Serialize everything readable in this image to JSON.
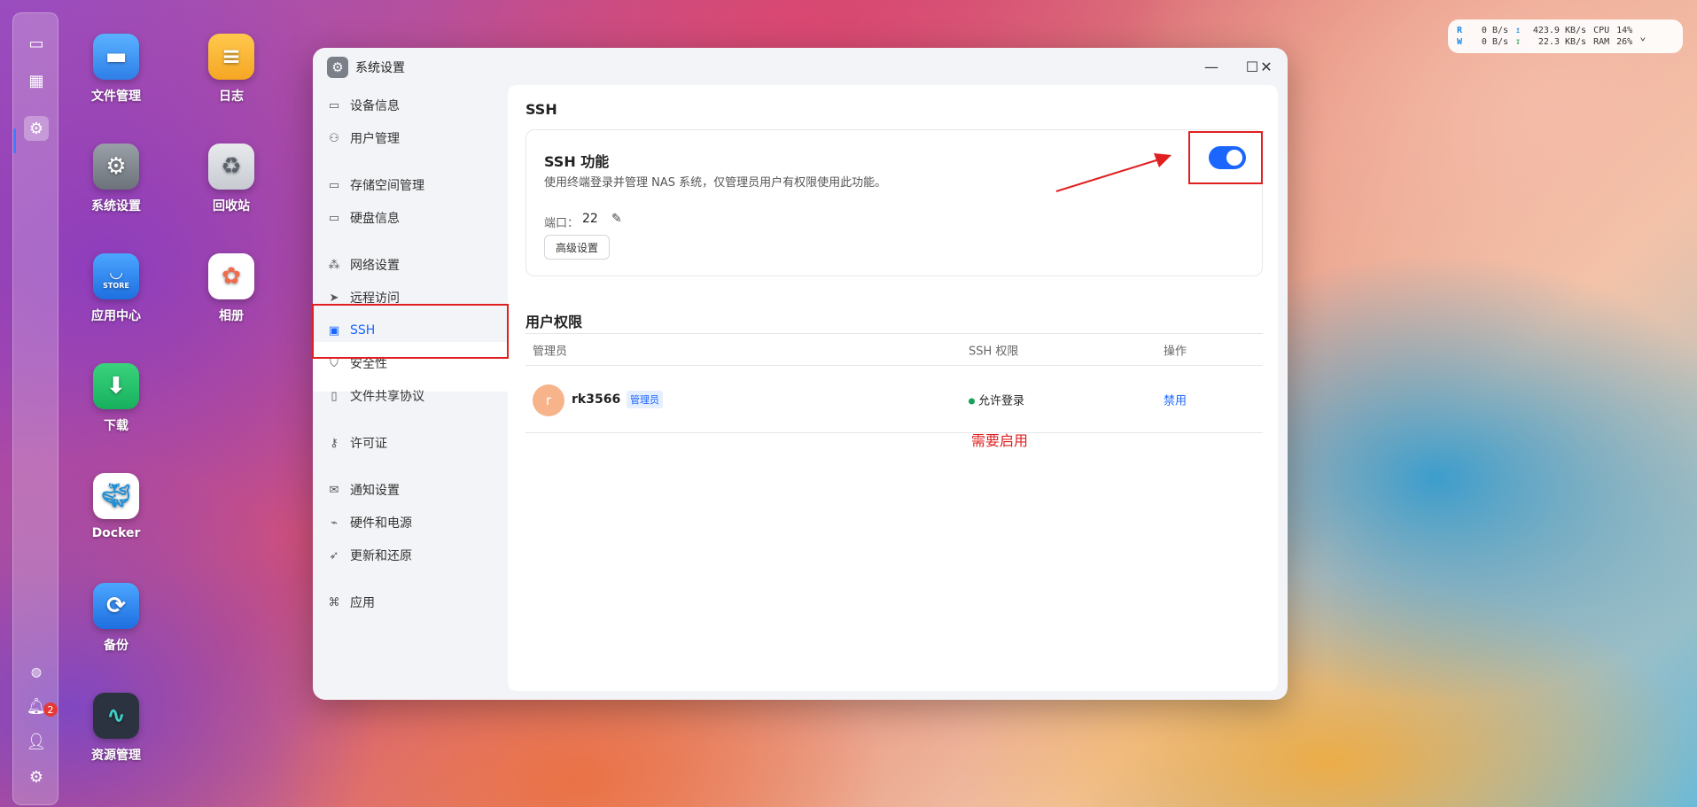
{
  "window": {
    "title": "系统设置"
  },
  "desktop_icons": [
    {
      "label": "文件管理",
      "icon": "folder-icon"
    },
    {
      "label": "日志",
      "icon": "log-icon"
    },
    {
      "label": "系统设置",
      "icon": "gear-icon"
    },
    {
      "label": "回收站",
      "icon": "recycle-bin-icon"
    },
    {
      "label": "应用中心",
      "icon": "store-icon",
      "sub": "STORE"
    },
    {
      "label": "相册",
      "icon": "photos-icon"
    },
    {
      "label": "下载",
      "icon": "download-icon"
    },
    {
      "label": "Docker",
      "icon": "docker-icon"
    },
    {
      "label": "备份",
      "icon": "backup-icon"
    },
    {
      "label": "资源管理",
      "icon": "resource-monitor-icon"
    }
  ],
  "dock": {
    "notification_count": "2"
  },
  "monitor": {
    "read_label": "R",
    "write_label": "W",
    "read_rate": "0  B/s",
    "write_rate": "0  B/s",
    "upload": "423.9 KB/s",
    "download": "22.3 KB/s",
    "cpu_label": "CPU",
    "cpu_value": "14%",
    "ram_label": "RAM",
    "ram_value": "26%"
  },
  "sidebar": {
    "items": [
      {
        "label": "设备信息",
        "icon": "drive-icon"
      },
      {
        "label": "用户管理",
        "icon": "user-icon"
      },
      {
        "label": "存储空间管理",
        "icon": "storage-icon"
      },
      {
        "label": "硬盘信息",
        "icon": "disk-icon"
      },
      {
        "label": "网络设置",
        "icon": "network-icon"
      },
      {
        "label": "远程访问",
        "icon": "send-icon"
      },
      {
        "label": "SSH",
        "icon": "terminal-icon"
      },
      {
        "label": "安全性",
        "icon": "shield-icon"
      },
      {
        "label": "文件共享协议",
        "icon": "file-icon"
      },
      {
        "label": "许可证",
        "icon": "key-icon"
      },
      {
        "label": "通知设置",
        "icon": "mail-icon"
      },
      {
        "label": "硬件和电源",
        "icon": "power-icon"
      },
      {
        "label": "更新和还原",
        "icon": "rocket-icon"
      },
      {
        "label": "应用",
        "icon": "apps-icon"
      }
    ]
  },
  "main": {
    "section_title": "SSH",
    "card": {
      "title": "SSH 功能",
      "description": "使用终端登录并管理 NAS 系统，仅管理员用户有权限使用此功能。",
      "port_label": "端口：",
      "port_value": "22",
      "advanced_button": "高级设置",
      "enabled": true
    },
    "permissions": {
      "title": "用户权限",
      "columns": [
        "管理员",
        "SSH 权限",
        "操作"
      ],
      "rows": [
        {
          "avatar": "r",
          "user": "rk3566",
          "role": "管理员",
          "permission": "允许登录",
          "action": "禁用"
        }
      ]
    }
  },
  "annotation": {
    "note": "需要启用",
    "color": "#e02020"
  },
  "colors": {
    "accent": "#1a66ff",
    "success": "#18a058"
  }
}
